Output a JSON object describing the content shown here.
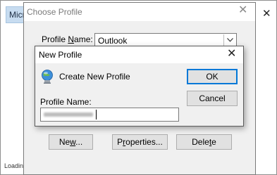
{
  "background": {
    "tab_label": "Micr",
    "close_glyph": "✕",
    "status_text": "Loadin"
  },
  "choose_profile": {
    "title": "Choose Profile",
    "close_glyph": "✕",
    "profile_name_label_pre": "Profile ",
    "profile_name_label_key": "N",
    "profile_name_label_post": "ame:",
    "profile_selected": "Outlook",
    "dropdown_icon": "chevron-down-icon",
    "buttons": {
      "new_pre": "Ne",
      "new_key": "w",
      "new_post": "...",
      "properties_pre": "P",
      "properties_key": "r",
      "properties_post": "operties...",
      "delete_pre": "Dele",
      "delete_key": "t",
      "delete_post": "e"
    }
  },
  "new_profile": {
    "title": "New Profile",
    "close_glyph": "✕",
    "create_text": "Create New Profile",
    "profile_name_label": "Profile Name:",
    "ok_label": "OK",
    "cancel_label": "Cancel"
  },
  "colors": {
    "dialog_bg": "#f0f0f0",
    "default_button_border": "#0078d7",
    "background_tab": "#c7dcf0"
  }
}
